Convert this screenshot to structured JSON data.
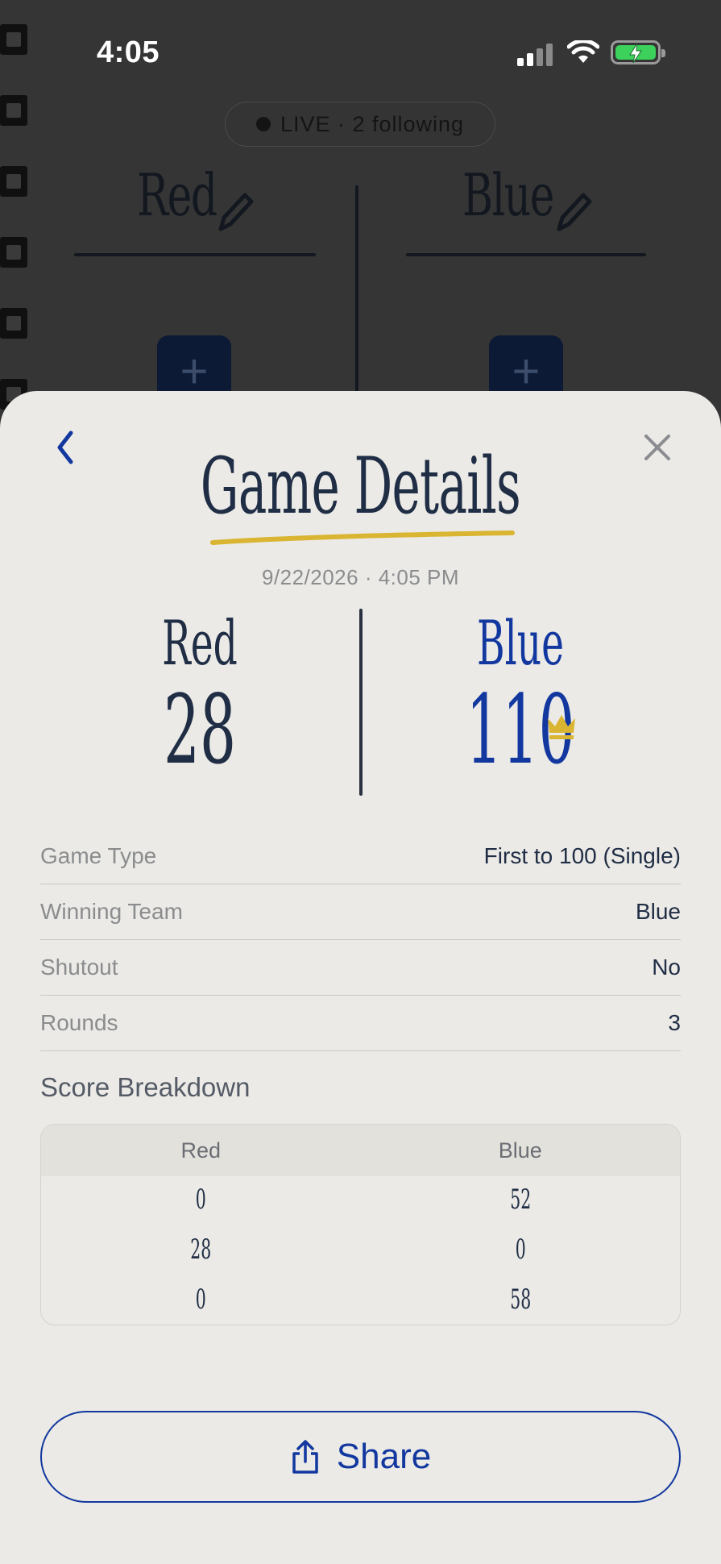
{
  "status_bar": {
    "time": "4:05"
  },
  "background": {
    "live_text": "LIVE · 2 following",
    "teams": [
      "Red",
      "Blue"
    ],
    "add_symbol": "+"
  },
  "sheet": {
    "title": "Game Details",
    "datetime": "9/22/2026 · 4:05 PM",
    "teams": [
      {
        "name": "Red",
        "score": "28"
      },
      {
        "name": "Blue",
        "score": "110"
      }
    ],
    "details": [
      {
        "label": "Game Type",
        "value": "First to 100 (Single)"
      },
      {
        "label": "Winning Team",
        "value": "Blue"
      },
      {
        "label": "Shutout",
        "value": "No"
      },
      {
        "label": "Rounds",
        "value": "3"
      }
    ],
    "breakdown": {
      "title": "Score Breakdown",
      "headers": [
        "Red",
        "Blue"
      ],
      "rows": [
        [
          "0",
          "52"
        ],
        [
          "28",
          "0"
        ],
        [
          "0",
          "58"
        ]
      ]
    },
    "share_label": "Share"
  },
  "colors": {
    "accent_blue": "#1238a0",
    "ink_navy": "#1f2d45",
    "highlight_yellow": "#d9b531",
    "sheet_bg": "#ebeae6"
  },
  "icons": [
    "back-chevron-icon",
    "close-icon",
    "pencil-icon",
    "crown-icon",
    "share-icon",
    "signal-icon",
    "wifi-icon",
    "battery-charging-icon"
  ]
}
